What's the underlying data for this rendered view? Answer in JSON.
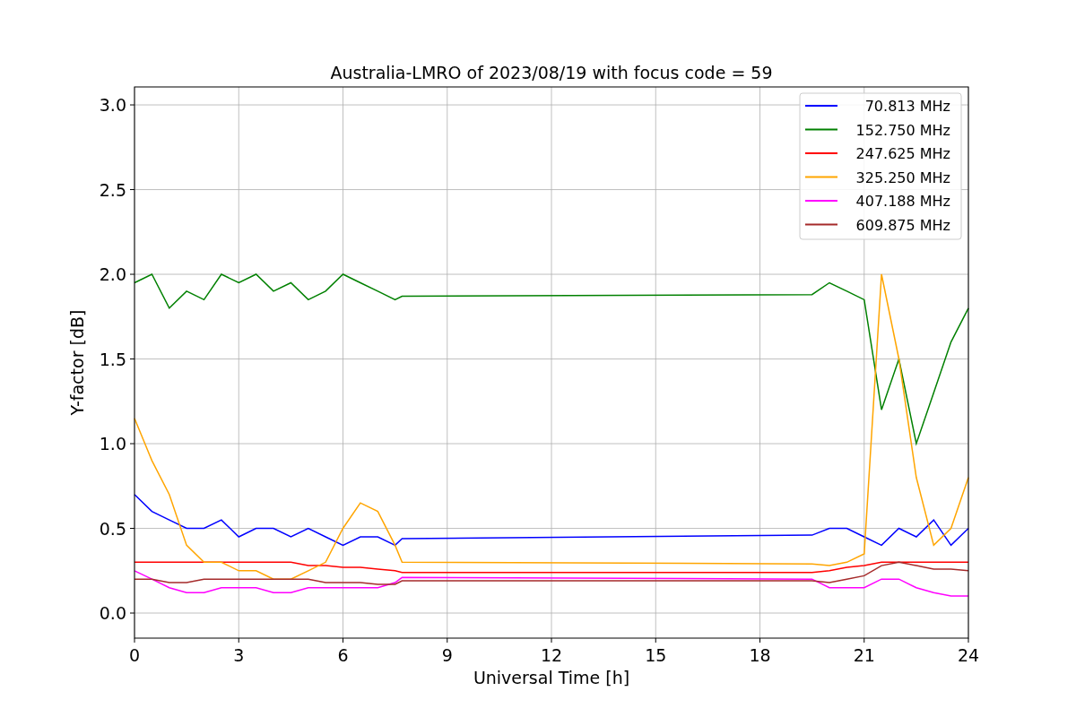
{
  "plot": {
    "chart_data": {
      "type": "line",
      "title": "Australia-LMRO of 2023/08/19 with focus code = 59",
      "xlabel": "Universal Time [h]",
      "ylabel": "Y-factor [dB]",
      "x": [
        0,
        0.5,
        1,
        1.5,
        2,
        2.5,
        3,
        3.5,
        4,
        4.5,
        5,
        5.5,
        6,
        6.5,
        7,
        7.5,
        7.7,
        19.5,
        20,
        20.5,
        21,
        21.5,
        22,
        22.5,
        23,
        23.5,
        24
      ],
      "series": [
        {
          "name": "70.813 MHz",
          "color": "#0000ff",
          "values": [
            0.7,
            0.6,
            0.55,
            0.5,
            0.5,
            0.55,
            0.45,
            0.5,
            0.5,
            0.45,
            0.5,
            0.45,
            0.4,
            0.45,
            0.45,
            0.4,
            0.44,
            0.46,
            0.5,
            0.5,
            0.45,
            0.4,
            0.5,
            0.45,
            0.55,
            0.4,
            0.5
          ]
        },
        {
          "name": "152.750 MHz",
          "color": "#008000",
          "values": [
            1.95,
            2.0,
            1.8,
            1.9,
            1.85,
            2.0,
            1.95,
            2.0,
            1.9,
            1.95,
            1.85,
            1.9,
            2.0,
            1.95,
            1.9,
            1.85,
            1.87,
            1.88,
            1.95,
            1.9,
            1.85,
            1.2,
            1.5,
            1.0,
            1.3,
            1.6,
            1.8
          ]
        },
        {
          "name": "247.625 MHz",
          "color": "#ff0000",
          "values": [
            0.3,
            0.3,
            0.3,
            0.3,
            0.3,
            0.3,
            0.3,
            0.3,
            0.3,
            0.3,
            0.28,
            0.28,
            0.27,
            0.27,
            0.26,
            0.25,
            0.24,
            0.24,
            0.25,
            0.27,
            0.28,
            0.3,
            0.3,
            0.3,
            0.3,
            0.3,
            0.3
          ]
        },
        {
          "name": "325.250 MHz",
          "color": "#ffa500",
          "values": [
            1.15,
            0.9,
            0.7,
            0.4,
            0.3,
            0.3,
            0.25,
            0.25,
            0.2,
            0.2,
            0.25,
            0.3,
            0.5,
            0.65,
            0.6,
            0.4,
            0.3,
            0.29,
            0.28,
            0.3,
            0.35,
            2.0,
            1.5,
            0.8,
            0.4,
            0.5,
            0.8
          ]
        },
        {
          "name": "407.188 MHz",
          "color": "#ff00ff",
          "values": [
            0.25,
            0.2,
            0.15,
            0.12,
            0.12,
            0.15,
            0.15,
            0.15,
            0.12,
            0.12,
            0.15,
            0.15,
            0.15,
            0.15,
            0.15,
            0.18,
            0.21,
            0.2,
            0.15,
            0.15,
            0.15,
            0.2,
            0.2,
            0.15,
            0.12,
            0.1,
            0.1
          ]
        },
        {
          "name": "609.875 MHz",
          "color": "#a52a2a",
          "values": [
            0.2,
            0.2,
            0.18,
            0.18,
            0.2,
            0.2,
            0.2,
            0.2,
            0.2,
            0.2,
            0.2,
            0.18,
            0.18,
            0.18,
            0.17,
            0.17,
            0.19,
            0.19,
            0.18,
            0.2,
            0.22,
            0.28,
            0.3,
            0.28,
            0.26,
            0.26,
            0.25
          ]
        }
      ],
      "grid": true,
      "legend": true,
      "xlim": [
        0,
        24
      ],
      "ylim": [
        -0.148,
        3.106
      ],
      "xticks": [
        0,
        3,
        6,
        9,
        12,
        15,
        18,
        21,
        24
      ],
      "yticks": [
        {
          "value": 0,
          "label": "0.0"
        },
        {
          "value": 0.5,
          "label": "0.5"
        },
        {
          "value": 1,
          "label": "1.0"
        },
        {
          "value": 1.5,
          "label": "1.5"
        },
        {
          "value": 2,
          "label": "2.0"
        },
        {
          "value": 2.5,
          "label": "2.5"
        },
        {
          "value": 3,
          "label": "3.0"
        }
      ]
    }
  }
}
